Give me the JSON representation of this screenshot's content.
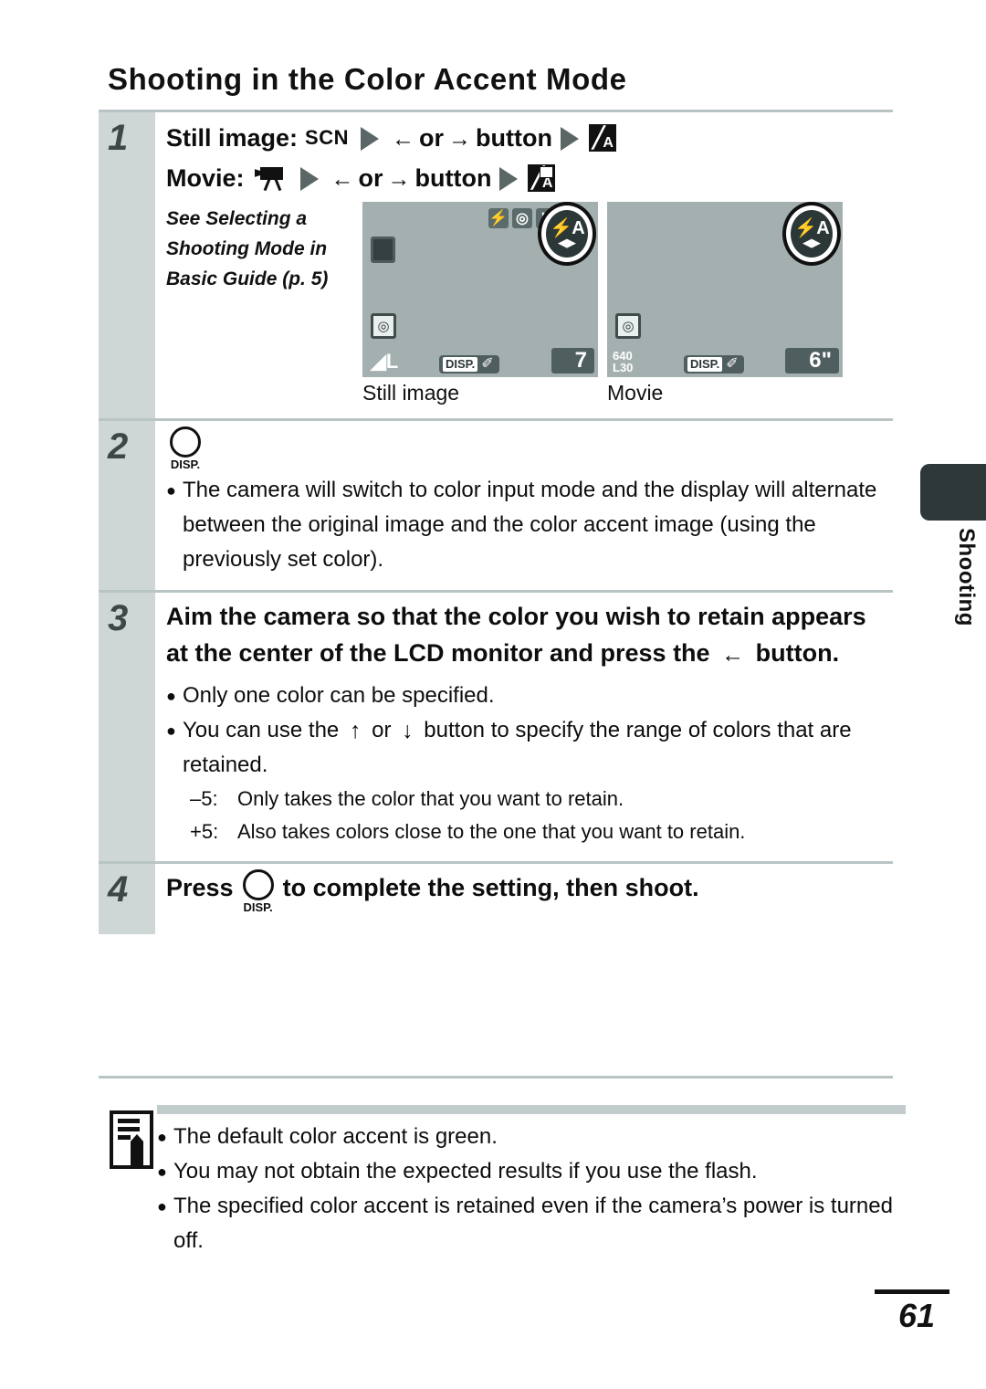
{
  "page": {
    "title": "Shooting in the Color Accent Mode",
    "number": "61",
    "index_tab_label": "Shooting"
  },
  "steps": [
    {
      "number": "1",
      "line1": {
        "label": "Still image:",
        "mode": "SCN",
        "arrow_left": "←",
        "or": "or",
        "arrow_right": "→",
        "button_word": "button"
      },
      "line2": {
        "label": "Movie:",
        "arrow_left": "←",
        "or": "or",
        "arrow_right": "→",
        "button_word": "button"
      },
      "caption": "See Selecting a Shooting Mode in Basic Guide (p. 5)",
      "lcds": [
        {
          "caption": "Still image",
          "flash_icon": "⚡",
          "metering_icon": "◎",
          "mode_icon": "⚑",
          "accent_badge_top": "⚡A",
          "accent_badge_bottom": "◀▶",
          "focus_box": "■",
          "af_icon": "◎",
          "quality": "◢L",
          "disp_label": "DISP.",
          "disp_pen": "✐",
          "counter": "7"
        },
        {
          "caption": "Movie",
          "accent_badge_top": "⚡A",
          "accent_badge_bottom": "◀▶",
          "af_icon": "◎",
          "movie_size_line1": "640",
          "movie_size_line2": "L30",
          "disp_label": "DISP.",
          "disp_pen": "✐",
          "counter": "6\""
        }
      ]
    },
    {
      "number": "2",
      "disp_button_label": "DISP.",
      "bullets": [
        "The camera will switch to color input mode and the display will alternate between the original image and the color accent image (using the previously set color)."
      ]
    },
    {
      "number": "3",
      "heading_part1": "Aim the camera so that the color you wish to retain appears at the center of the LCD monitor and press the",
      "heading_arrow": "←",
      "heading_part2": "button.",
      "bullets": [
        "Only one color can be specified.",
        "You can use the ↑ or ↓ button to specify the range of colors that are retained."
      ],
      "bullet2_pre": "You can use the",
      "bullet2_arrow_up": "↑",
      "bullet2_or": "or",
      "bullet2_arrow_down": "↓",
      "bullet2_post": "button to specify the range of colors that are retained.",
      "sub_items": [
        {
          "key": "–5:",
          "value": "Only takes the color that you want to retain."
        },
        {
          "key": "+5:",
          "value": "Also takes colors close to the one that you want to retain."
        }
      ]
    },
    {
      "number": "4",
      "heading_part1": "Press",
      "disp_button_label": "DISP.",
      "heading_part2": "to complete the setting, then shoot."
    }
  ],
  "note": {
    "bullets": [
      "The default color accent is green.",
      "You may not obtain the expected results if you use the flash.",
      "The specified color accent is retained even if the camera’s power is turned off."
    ]
  },
  "bullet_glyph": "●"
}
